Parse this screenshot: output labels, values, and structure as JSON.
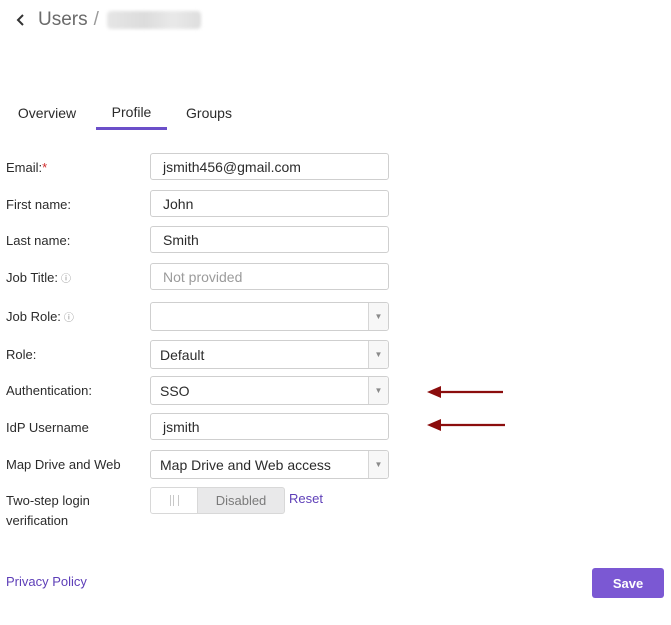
{
  "header": {
    "back_icon": "chevron-left-icon",
    "title": "Users",
    "separator": "/"
  },
  "tabs": [
    {
      "label": "Overview",
      "active": false
    },
    {
      "label": "Profile",
      "active": true
    },
    {
      "label": "Groups",
      "active": false
    }
  ],
  "form": {
    "email": {
      "label": "Email:",
      "required_mark": "*",
      "value": "jsmith456@gmail.com"
    },
    "first_name": {
      "label": "First name:",
      "value": "John"
    },
    "last_name": {
      "label": "Last name:",
      "value": "Smith"
    },
    "job_title": {
      "label": "Job Title:",
      "info_icon": "info-icon",
      "value": "",
      "placeholder": "Not provided"
    },
    "job_role": {
      "label": "Job Role:",
      "info_icon": "info-icon",
      "value": ""
    },
    "role": {
      "label": "Role:",
      "value": "Default"
    },
    "authentication": {
      "label": "Authentication:",
      "value": "SSO"
    },
    "idp_username": {
      "label": "IdP Username",
      "value": "jsmith"
    },
    "map_drive": {
      "label": "Map Drive and Web",
      "value": "Map Drive and Web access"
    },
    "two_step": {
      "label_line1": "Two-step login",
      "label_line2": "verification",
      "state": "Disabled",
      "reset_label": "Reset"
    }
  },
  "annotations": {
    "arrow_color": "#8b0d0d"
  },
  "footer": {
    "privacy_link": "Privacy Policy",
    "save_label": "Save"
  },
  "colors": {
    "accent": "#7b58d3",
    "tab_underline": "#6b4fc9",
    "required": "#d12b2b"
  }
}
